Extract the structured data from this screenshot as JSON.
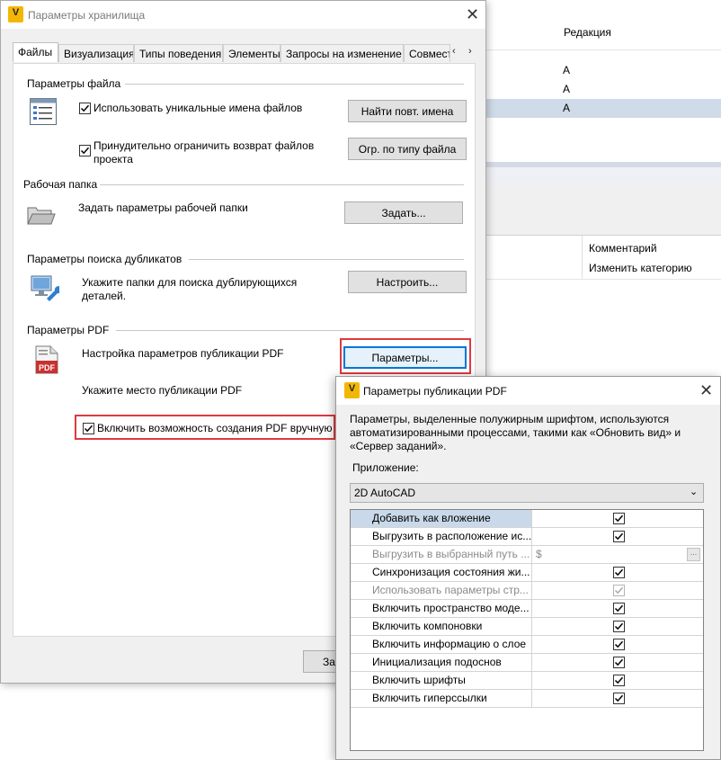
{
  "background": {
    "header_column": "Редакция",
    "rows": [
      "A",
      "A",
      "A"
    ],
    "list_items": [
      "Комментарий",
      "Изменить категорию"
    ]
  },
  "main_dialog": {
    "title": "Параметры хранилища",
    "tabs": [
      "Файлы",
      "Визуализация",
      "Типы поведения",
      "Элементы",
      "Запросы на изменение",
      "Совмест"
    ],
    "file_params": {
      "title": "Параметры файла",
      "unique_names_label": "Использовать уникальные имена файлов",
      "unique_names_checked": true,
      "find_button": "Найти повт. имена",
      "restrict_label_line1": "Принудительно ограничить возврат файлов",
      "restrict_label_line2": "проекта",
      "restrict_checked": true,
      "restrict_button": "Огр. по типу файла"
    },
    "work_folder": {
      "title": "Рабочая папка",
      "label": "Задать параметры рабочей папки",
      "button": "Задать..."
    },
    "duplicates": {
      "title": "Параметры поиска дубликатов",
      "label_line1": "Укажите папки для поиска дублирующихся",
      "label_line2": "деталей.",
      "button": "Настроить..."
    },
    "pdf": {
      "title": "Параметры PDF",
      "publish_label": "Настройка параметров публикации PDF",
      "publish_button": "Параметры...",
      "location_label": "Укажите место публикации PDF",
      "manual_label": "Включить возможность создания PDF вручную",
      "manual_checked": true
    },
    "bottom_button_partial": "За"
  },
  "pdf_dialog": {
    "title": "Параметры публикации PDF",
    "description_line1": "Параметры, выделенные полужирным шрифтом, используются",
    "description_line2": "автоматизированными процессами, такими как «Обновить вид» и",
    "description_line3": "«Сервер заданий».",
    "application_label": "Приложение:",
    "application_value": "2D AutoCAD",
    "rows": [
      {
        "name": "Добавить как вложение",
        "checked": true,
        "disabled": false,
        "selected": true
      },
      {
        "name": "Выгрузить в расположение ис...",
        "checked": true,
        "disabled": false,
        "selected": false
      },
      {
        "name": "Выгрузить в выбранный путь ...",
        "value": "$",
        "disabled": true,
        "selected": false
      },
      {
        "name": "Синхронизация состояния жи...",
        "checked": true,
        "disabled": false,
        "selected": false
      },
      {
        "name": "Использовать параметры стр...",
        "checked": true,
        "disabled": true,
        "selected": false
      },
      {
        "name": "Включить пространство моде...",
        "checked": true,
        "disabled": false,
        "selected": false
      },
      {
        "name": "Включить компоновки",
        "checked": true,
        "disabled": false,
        "selected": false
      },
      {
        "name": "Включить информацию о слое",
        "checked": true,
        "disabled": false,
        "selected": false
      },
      {
        "name": "Инициализация подоснов",
        "checked": true,
        "disabled": false,
        "selected": false
      },
      {
        "name": "Включить шрифты",
        "checked": true,
        "disabled": false,
        "selected": false
      },
      {
        "name": "Включить гиперссылки",
        "checked": true,
        "disabled": false,
        "selected": false
      }
    ],
    "browse_button": "...",
    "app_icon_letter": "V"
  },
  "colors": {
    "highlight_red": "#e0393e",
    "selection_blue": "#c9d9ea",
    "focus_blue": "#0078d7",
    "app_icon_yellow": "#f2b705"
  }
}
